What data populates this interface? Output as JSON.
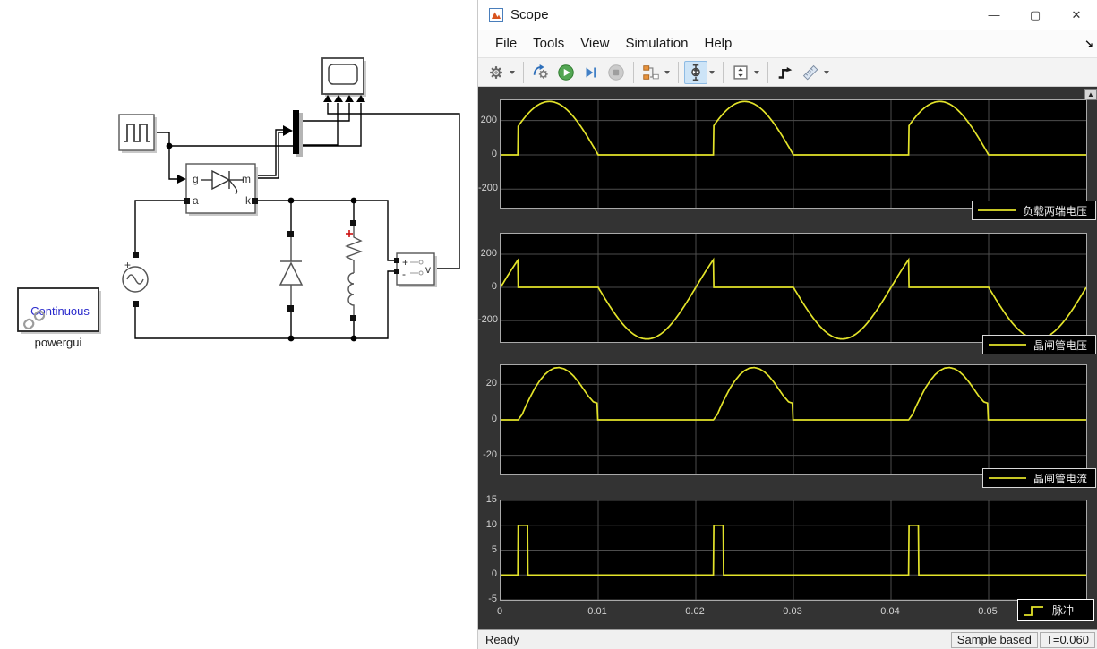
{
  "window": {
    "title": "Scope",
    "controls": {
      "minimize": "—",
      "maximize": "▢",
      "close": "✕"
    }
  },
  "menu": {
    "items": [
      "File",
      "Tools",
      "View",
      "Simulation",
      "Help"
    ]
  },
  "icons": {
    "overflow": "↘",
    "dock": "▲"
  },
  "toolbar": {
    "buttons": [
      {
        "icon": "settings-gear-icon",
        "dropdown": true
      },
      {
        "sep": true
      },
      {
        "icon": "highlight-model-icon"
      },
      {
        "icon": "run-icon"
      },
      {
        "icon": "step-forward-icon"
      },
      {
        "icon": "stop-icon",
        "disabled": true
      },
      {
        "sep": true
      },
      {
        "icon": "signal-selector-icon",
        "dropdown": true
      },
      {
        "sep": true
      },
      {
        "icon": "scale-axes-icon",
        "dropdown": true,
        "active": true
      },
      {
        "sep": true
      },
      {
        "icon": "y-limits-icon",
        "dropdown": true
      },
      {
        "sep": true
      },
      {
        "icon": "trigger-icon"
      },
      {
        "icon": "measurements-icon",
        "dropdown": true
      }
    ]
  },
  "statusbar": {
    "left": "Ready",
    "sample": "Sample based",
    "time": "T=0.060"
  },
  "diagram": {
    "powergui": {
      "mode": "Continuous",
      "label": "powergui"
    },
    "thyristor_ports": {
      "g": "g",
      "a": "a",
      "m": "m",
      "k": "k"
    },
    "source_plus": "+",
    "voltmeter": {
      "plus": "+",
      "minus": "-",
      "label": "v"
    },
    "load_plus": "+"
  },
  "chart_data": [
    {
      "type": "line",
      "legend": "负载两端电压",
      "legend_glyph": "line",
      "color": "#e3e32a",
      "x": {
        "min": 0,
        "max": 0.06,
        "grid": [
          0.01,
          0.02,
          0.03,
          0.04,
          0.05
        ]
      },
      "y": {
        "min": -308,
        "max": 318,
        "ticks": [
          {
            "v": 200,
            "label": "200"
          },
          {
            "v": 0,
            "label": "0"
          },
          {
            "v": -200,
            "label": "-200"
          }
        ]
      },
      "signal": {
        "kind": "gated_sine",
        "amplitude": 311,
        "freq_hz": 50,
        "fire_time": 0.0018,
        "conduction_end": 0.01,
        "period": 0.02
      }
    },
    {
      "type": "line",
      "legend": "晶闸管电压",
      "legend_glyph": "line",
      "color": "#e3e32a",
      "x": {
        "min": 0,
        "max": 0.06,
        "grid": [
          0.01,
          0.02,
          0.03,
          0.04,
          0.05
        ]
      },
      "y": {
        "min": -329,
        "max": 324,
        "ticks": [
          {
            "v": 200,
            "label": "200"
          },
          {
            "v": 0,
            "label": "0"
          },
          {
            "v": -200,
            "label": "-200"
          }
        ]
      },
      "signal": {
        "kind": "blocking_sine",
        "amplitude": 311,
        "freq_hz": 50,
        "fire_time": 0.0018,
        "conduction_end": 0.01,
        "period": 0.02
      }
    },
    {
      "type": "line",
      "legend": "晶闸管电流",
      "legend_glyph": "line",
      "color": "#e3e32a",
      "x": {
        "min": 0,
        "max": 0.06,
        "grid": [
          0.01,
          0.02,
          0.03,
          0.04,
          0.05
        ]
      },
      "y": {
        "min": -30.8,
        "max": 30.8,
        "ticks": [
          {
            "v": 20,
            "label": "20"
          },
          {
            "v": 0,
            "label": "0"
          },
          {
            "v": -20,
            "label": "-20"
          }
        ]
      },
      "signal": {
        "kind": "sampled_periodic",
        "period": 0.02,
        "points": [
          [
            0,
            0
          ],
          [
            0.0018,
            0
          ],
          [
            0.0022,
            3
          ],
          [
            0.0026,
            8
          ],
          [
            0.003,
            12.5
          ],
          [
            0.0035,
            17.8
          ],
          [
            0.004,
            22
          ],
          [
            0.0045,
            25.4
          ],
          [
            0.005,
            27.8
          ],
          [
            0.0055,
            29.2
          ],
          [
            0.006,
            29.5
          ],
          [
            0.0065,
            28.8
          ],
          [
            0.007,
            27.2
          ],
          [
            0.0075,
            24.6
          ],
          [
            0.008,
            21.2
          ],
          [
            0.0085,
            17.3
          ],
          [
            0.009,
            13.3
          ],
          [
            0.0095,
            10.2
          ],
          [
            0.0099,
            9.4
          ],
          [
            0.00995,
            0
          ],
          [
            0.02,
            0
          ]
        ]
      }
    },
    {
      "type": "line",
      "legend": "脉冲",
      "legend_glyph": "step",
      "color": "#e3e32a",
      "x": {
        "min": 0,
        "max": 0.06,
        "grid": [
          0.01,
          0.02,
          0.03,
          0.04,
          0.05
        ],
        "ticks": [
          {
            "v": 0,
            "label": "0"
          },
          {
            "v": 0.01,
            "label": "0.01"
          },
          {
            "v": 0.02,
            "label": "0.02"
          },
          {
            "v": 0.03,
            "label": "0.03"
          },
          {
            "v": 0.04,
            "label": "0.04"
          },
          {
            "v": 0.05,
            "label": "0.05"
          }
        ]
      },
      "y": {
        "min": -5,
        "max": 15,
        "ticks": [
          {
            "v": 15,
            "label": "15"
          },
          {
            "v": 10,
            "label": "10"
          },
          {
            "v": 5,
            "label": "5"
          },
          {
            "v": 0,
            "label": "0"
          },
          {
            "v": -5,
            "label": "-5"
          }
        ]
      },
      "signal": {
        "kind": "pulse_train",
        "period": 0.02,
        "t_on": 0.0018,
        "width": 0.001,
        "high": 10,
        "low": 0
      }
    }
  ]
}
